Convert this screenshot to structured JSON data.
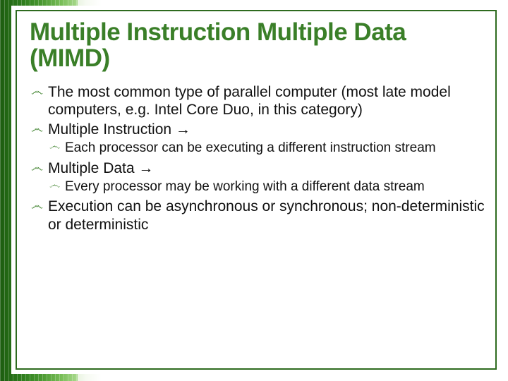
{
  "bullet_glyph": "෴",
  "title": "Multiple Instruction Multiple Data (MIMD)",
  "items": [
    {
      "text": "The most common type of parallel computer (most late model computers, e.g. Intel Core Duo, in this category)",
      "sub": []
    },
    {
      "text": "Multiple Instruction →",
      "sub": [
        "Each processor can be executing a different instruction stream"
      ]
    },
    {
      "text": "Multiple Data →",
      "sub": [
        "Every processor may be working with a different data stream"
      ]
    },
    {
      "text": "Execution can be asynchronous or synchronous; non-deterministic or deterministic",
      "sub": []
    }
  ]
}
